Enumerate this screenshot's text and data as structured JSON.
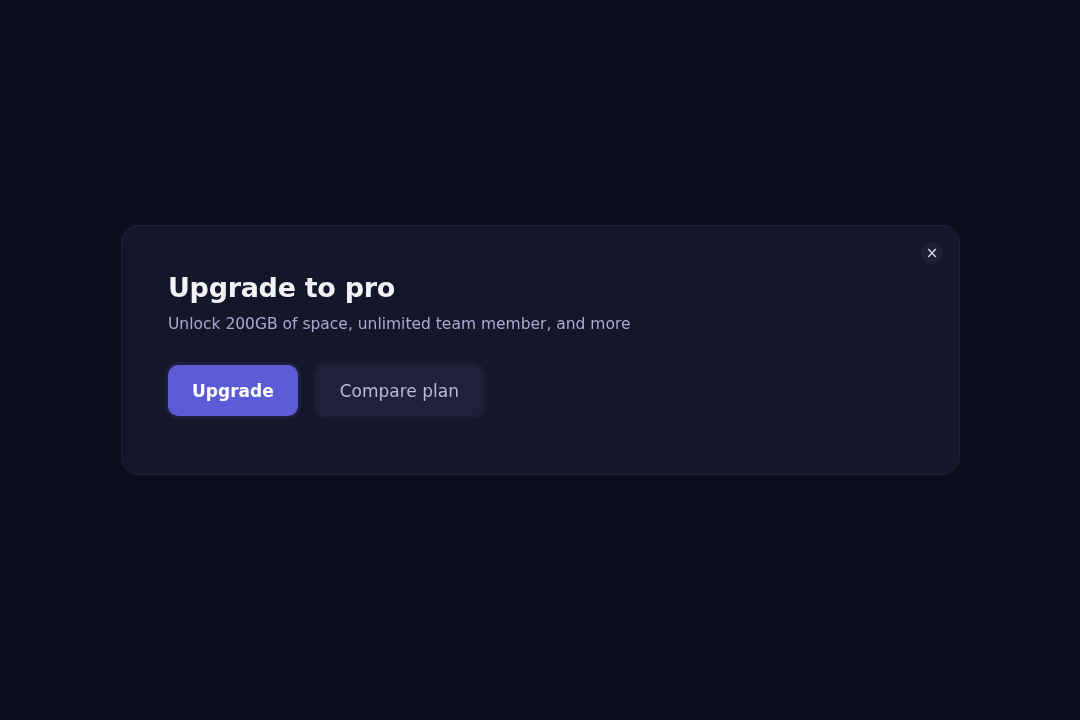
{
  "dialog": {
    "close": "×",
    "title": "Upgrade to pro",
    "description": "Unlock 200GB of space, unlimited team member, and more",
    "buttons": [
      {
        "label": "Upgrade",
        "kind": "primary"
      },
      {
        "label": "Compare plan",
        "kind": "secondary"
      }
    ]
  }
}
